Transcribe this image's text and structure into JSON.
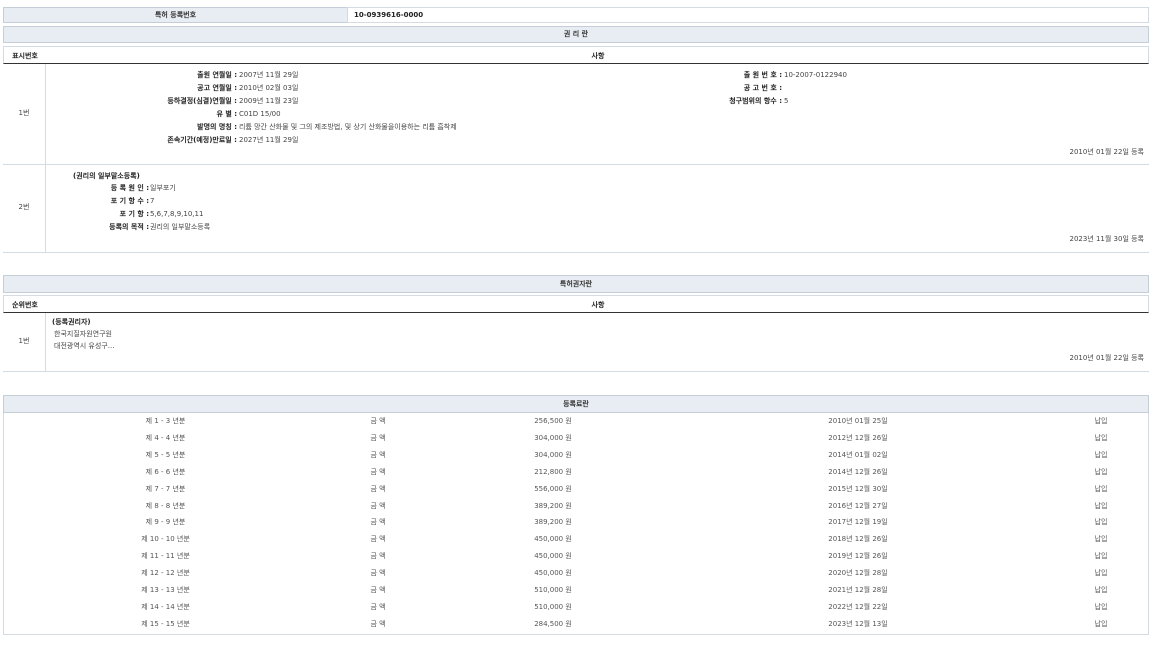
{
  "top": {
    "label": "특허 등록번호",
    "value": "10-0939616-0000"
  },
  "rights": {
    "title": "권 리 란",
    "col_num": "표시번호",
    "col_desc": "사항",
    "entry1": {
      "num": "1번",
      "left": [
        {
          "label": "출원 연월일 :",
          "value": "2007년 11월 29일"
        },
        {
          "label": "공고 연월일 :",
          "value": "2010년 02월 03일"
        },
        {
          "label": "등하결정(심결)연월일 :",
          "value": "2009년 11월 23일"
        },
        {
          "label": "유 별 :",
          "value": "C01D 15/00"
        },
        {
          "label": "발명의 명칭 :",
          "value": "리튬 망간 산화물 및 그의 제조방법, 및 상기 산화물을이용하는 리튬 흡착제"
        },
        {
          "label": "존속기간(예정)만료일 :",
          "value": "2027년 11월 29일"
        }
      ],
      "right": [
        {
          "label": "출 원 번 호 :",
          "value": "10-2007-0122940"
        },
        {
          "label": "공 고 번 호 :",
          "value": ""
        },
        {
          "label": "청구범위의 항수 :",
          "value": "5"
        }
      ],
      "date": "2010년 01월 22일 등록"
    },
    "entry2": {
      "num": "2번",
      "heading": "(권리의 일부말소등록)",
      "items": [
        {
          "label": "등 록 원 인 :",
          "value": "일부포기"
        },
        {
          "label": "포 기 항 수 :",
          "value": "7"
        },
        {
          "label": "포 기 항 :",
          "value": "5,6,7,8,9,10,11"
        },
        {
          "label": "등록의 목적 :",
          "value": "권리의 일부말소등록"
        }
      ],
      "date": "2023년 11월 30일 등록"
    }
  },
  "owners": {
    "title": "특허권자란",
    "col_num": "순위번호",
    "col_desc": "사항",
    "entry1": {
      "num": "1번",
      "heading": "(등록권리자)",
      "lines": [
        "한국지질자원연구원",
        "대전광역시 유성구..."
      ],
      "date": "2010년 01월 22일 등록"
    }
  },
  "fees": {
    "title": "등록료란",
    "rows": [
      {
        "period": "제 1 - 3 년분",
        "label": "금 액",
        "amount": "256,500 원",
        "date": "2010년 01월 25일",
        "status": "납입"
      },
      {
        "period": "제 4 - 4 년분",
        "label": "금 액",
        "amount": "304,000 원",
        "date": "2012년 12월 26일",
        "status": "납입"
      },
      {
        "period": "제 5 - 5 년분",
        "label": "금 액",
        "amount": "304,000 원",
        "date": "2014년 01월 02일",
        "status": "납입"
      },
      {
        "period": "제 6 - 6 년분",
        "label": "금 액",
        "amount": "212,800 원",
        "date": "2014년 12월 26일",
        "status": "납입"
      },
      {
        "period": "제 7 - 7 년분",
        "label": "금 액",
        "amount": "556,000 원",
        "date": "2015년 12월 30일",
        "status": "납입"
      },
      {
        "period": "제 8 - 8 년분",
        "label": "금 액",
        "amount": "389,200 원",
        "date": "2016년 12월 27일",
        "status": "납입"
      },
      {
        "period": "제 9 - 9 년분",
        "label": "금 액",
        "amount": "389,200 원",
        "date": "2017년 12월 19일",
        "status": "납입"
      },
      {
        "period": "제 10 - 10 년분",
        "label": "금 액",
        "amount": "450,000 원",
        "date": "2018년 12월 26일",
        "status": "납입"
      },
      {
        "period": "제 11 - 11 년분",
        "label": "금 액",
        "amount": "450,000 원",
        "date": "2019년 12월 26일",
        "status": "납입"
      },
      {
        "period": "제 12 - 12 년분",
        "label": "금 액",
        "amount": "450,000 원",
        "date": "2020년 12월 28일",
        "status": "납입"
      },
      {
        "period": "제 13 - 13 년분",
        "label": "금 액",
        "amount": "510,000 원",
        "date": "2021년 12월 28일",
        "status": "납입"
      },
      {
        "period": "제 14 - 14 년분",
        "label": "금 액",
        "amount": "510,000 원",
        "date": "2022년 12월 22일",
        "status": "납입"
      },
      {
        "period": "제 15 - 15 년분",
        "label": "금 액",
        "amount": "284,500 원",
        "date": "2023년 12월 13일",
        "status": "납입"
      }
    ]
  }
}
